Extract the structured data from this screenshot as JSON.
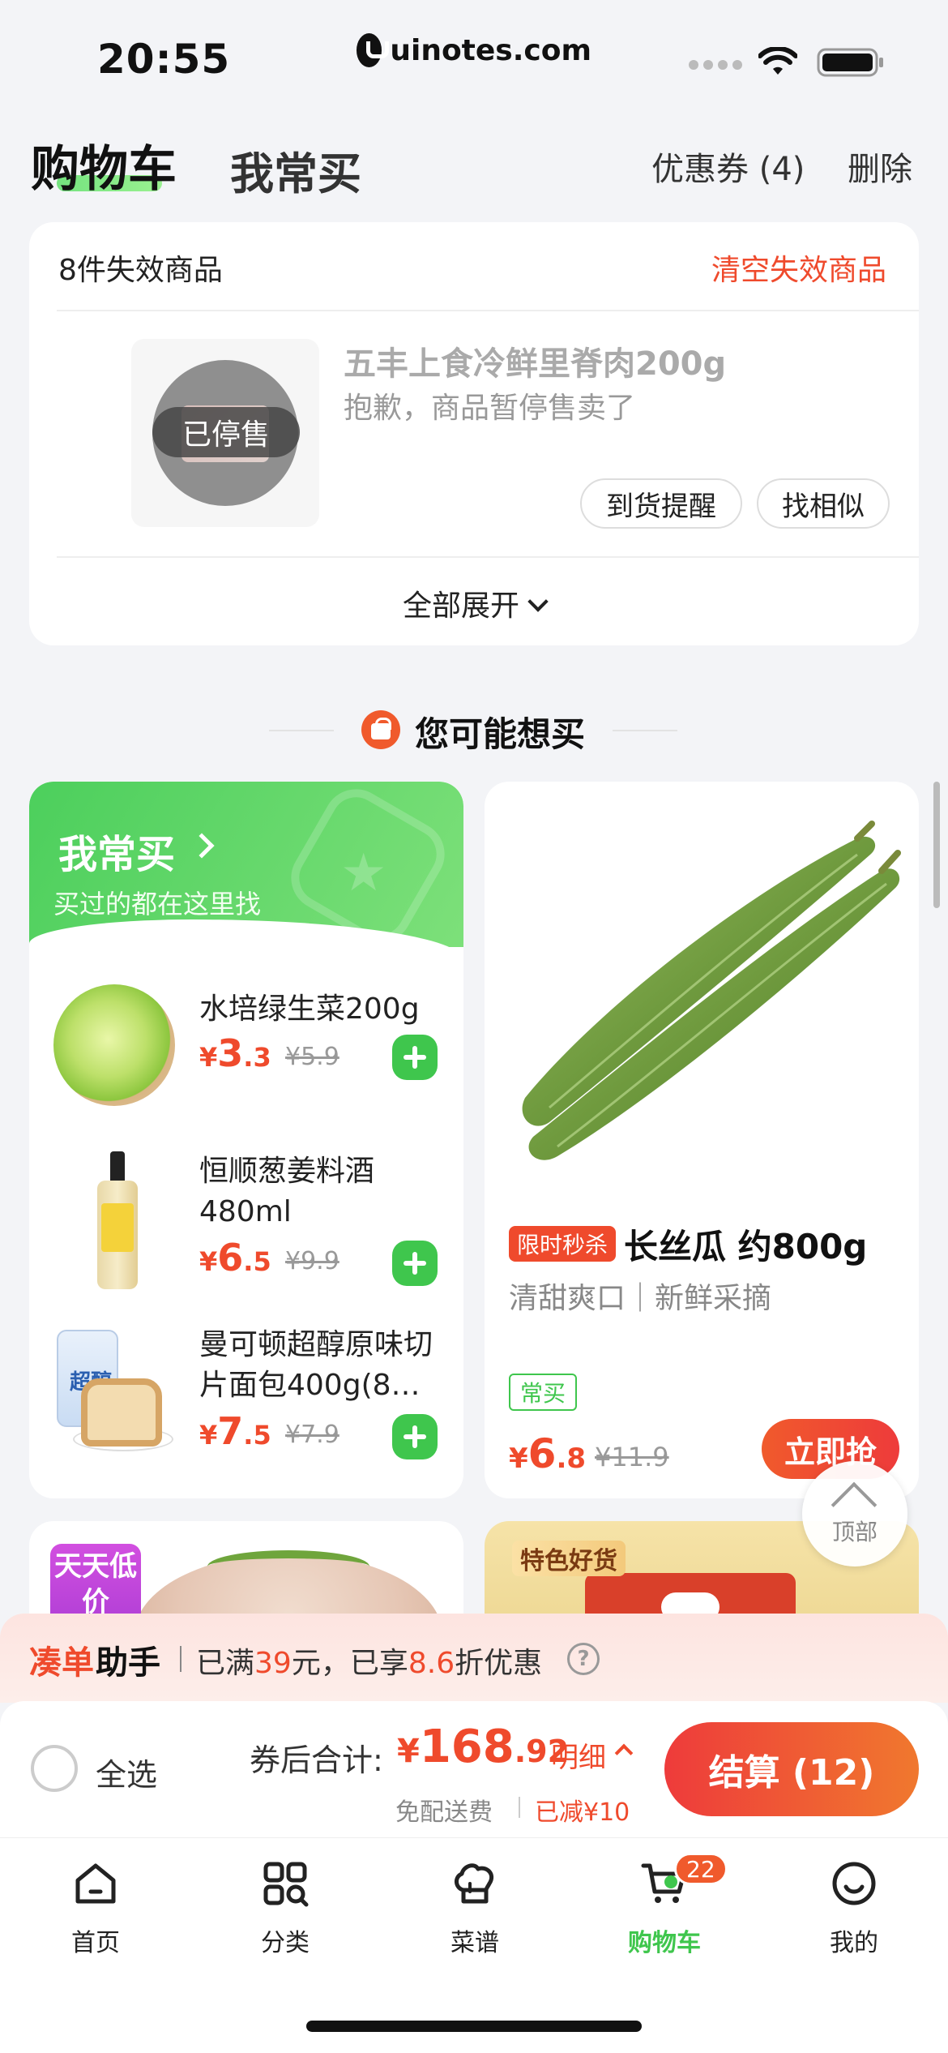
{
  "status_bar": {
    "time": "20:55",
    "url": "uinotes.com"
  },
  "header": {
    "tab_cart": "购物车",
    "tab_frequent": "我常买",
    "coupon": "优惠券 (4)",
    "delete": "删除"
  },
  "invalid_section": {
    "count_label": "8件失效商品",
    "clear_label": "清空失效商品",
    "product_title": "五丰上食冷鲜里脊肉200g",
    "product_note": "抱歉，商品暂停售卖了",
    "status_badge": "已停售",
    "notify_button": "到货提醒",
    "similar_button": "找相似",
    "expand_all": "全部展开"
  },
  "recommend": {
    "title": "您可能想买"
  },
  "frequent_card": {
    "title": "我常买",
    "subtitle": "买过的都在这里找",
    "items": [
      {
        "name": "水培绿生菜200g",
        "price_yen": "¥",
        "price_int": "3",
        "price_dec": ".3",
        "price_old": "¥5.9",
        "image_icon": "lettuce"
      },
      {
        "name": "恒顺葱姜料酒480ml",
        "price_yen": "¥",
        "price_int": "6",
        "price_dec": ".5",
        "price_old": "¥9.9",
        "image_icon": "cooking-wine-bottle"
      },
      {
        "name": "曼可顿超醇原味切片面包400g(8…",
        "price_yen": "¥",
        "price_int": "7",
        "price_dec": ".5",
        "price_old": "¥7.9",
        "image_icon": "sliced-bread",
        "package_text": "超醇"
      }
    ]
  },
  "promo_card": {
    "image_icon": "luffa",
    "badge": "限时秒杀",
    "name": "长丝瓜 约800g",
    "desc": "清甜爽口｜新鲜采摘",
    "tag": "常买",
    "price_yen": "¥",
    "price_int": "6",
    "price_dec": ".8",
    "price_old": "¥11.9",
    "buy_button": "立即抢"
  },
  "back_to_top": {
    "label": "顶部"
  },
  "partial_cards": {
    "left_badge": "天天低价",
    "right_badge": "特色好货"
  },
  "helper": {
    "title_a": "凑单",
    "title_b": "助手",
    "text_prefix": "已满",
    "amount": "39",
    "text_mid": "元，已享",
    "discount": "8.6",
    "text_suffix": "折优惠",
    "help_mark": "?"
  },
  "checkout": {
    "select_all": "全选",
    "total_label": "券后合计:",
    "total_yen": "¥",
    "total_int": "168",
    "total_dec": ".92",
    "detail_link": "明细",
    "free_shipping": "免配送费",
    "discounted": "已减¥10",
    "checkout_button": "结算 (12)"
  },
  "tab_bar": {
    "items": [
      {
        "label": "首页",
        "icon": "home-icon"
      },
      {
        "label": "分类",
        "icon": "category-icon"
      },
      {
        "label": "菜谱",
        "icon": "recipe-chef-hat-icon"
      },
      {
        "label": "购物车",
        "icon": "cart-icon"
      },
      {
        "label": "我的",
        "icon": "profile-icon"
      }
    ],
    "cart_badge": "22",
    "active_index": 3
  },
  "colors": {
    "accent_red": "#ef4a2c",
    "accent_green": "#3fc64d",
    "background": "#f3f4f7"
  }
}
